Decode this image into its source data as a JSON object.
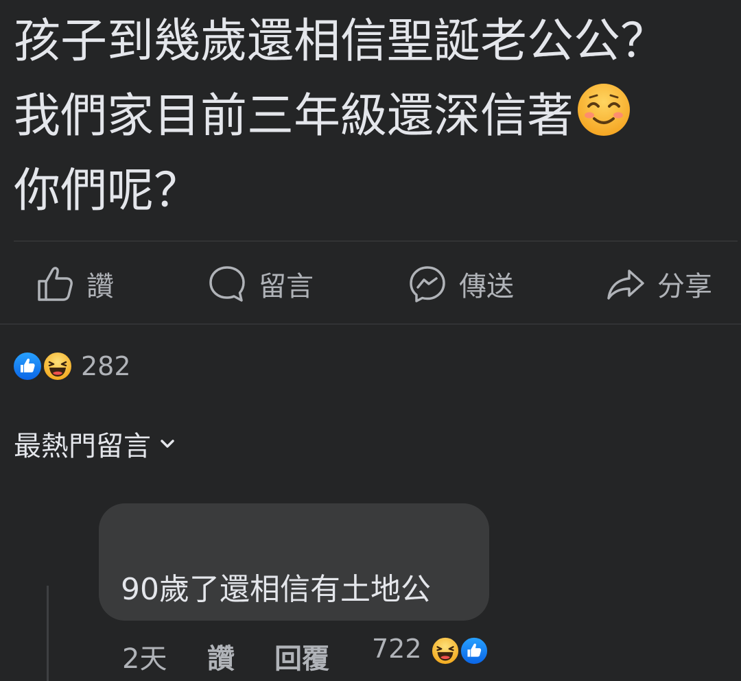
{
  "post": {
    "lines": [
      "孩子到幾歲還相信聖誕老公公？",
      "我們家目前三年級還深信著",
      "你們呢？"
    ],
    "emoji": "smiling-face-with-smiling-eyes"
  },
  "actions": {
    "like": "讚",
    "comment": "留言",
    "send": "傳送",
    "share": "分享"
  },
  "reactions": {
    "types": [
      "like",
      "haha"
    ],
    "count": "282"
  },
  "comments_sort": {
    "label": "最熱門留言"
  },
  "comments": [
    {
      "text": "90歲了還相信有土地公",
      "time": "2天",
      "like_label": "讚",
      "reply_label": "回覆",
      "reaction_count": "722",
      "reaction_types": [
        "haha",
        "like"
      ]
    }
  ],
  "colors": {
    "background": "#242526",
    "text_primary": "#e4e6eb",
    "text_secondary": "#b0b3b8",
    "bubble": "#3a3b3c",
    "like_blue": "#1877f2",
    "haha_yellow": "#f7b125"
  }
}
